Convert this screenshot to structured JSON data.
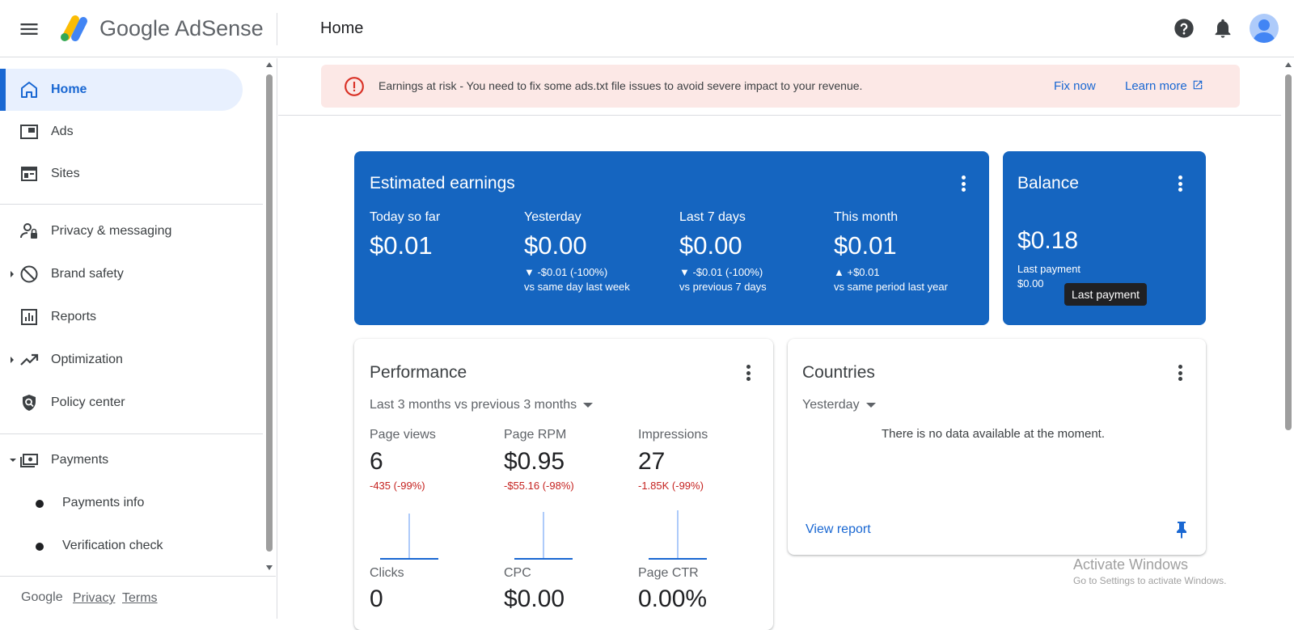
{
  "header": {
    "brand": "Google AdSense",
    "page_title": "Home"
  },
  "sidebar": {
    "items": [
      {
        "label": "Home",
        "icon": "home-icon"
      },
      {
        "label": "Ads",
        "icon": "ads-icon"
      },
      {
        "label": "Sites",
        "icon": "sites-icon"
      },
      {
        "label": "Privacy & messaging",
        "icon": "privacy-icon"
      },
      {
        "label": "Brand safety",
        "icon": "block-icon"
      },
      {
        "label": "Reports",
        "icon": "reports-icon"
      },
      {
        "label": "Optimization",
        "icon": "trending-icon"
      },
      {
        "label": "Policy center",
        "icon": "policy-icon"
      },
      {
        "label": "Payments",
        "icon": "payments-icon"
      }
    ],
    "subitems": [
      {
        "label": "Payments info"
      },
      {
        "label": "Verification check"
      }
    ],
    "footer": {
      "google": "Google",
      "privacy": "Privacy",
      "terms": "Terms"
    }
  },
  "alert": {
    "text": "Earnings at risk - You need to fix some ads.txt file issues to avoid severe impact to your revenue.",
    "fix": "Fix now",
    "learn": "Learn more",
    "color": "#d93025"
  },
  "earnings": {
    "title": "Estimated earnings",
    "metrics": [
      {
        "label": "Today so far",
        "value": "$0.01",
        "change": "",
        "compare": ""
      },
      {
        "label": "Yesterday",
        "value": "$0.00",
        "change": "▼ -$0.01 (-100%)",
        "compare": "vs same day last week"
      },
      {
        "label": "Last 7 days",
        "value": "$0.00",
        "change": "▼ -$0.01 (-100%)",
        "compare": "vs previous 7 days"
      },
      {
        "label": "This month",
        "value": "$0.01",
        "change": "▲ +$0.01",
        "compare": "vs same period last year"
      }
    ]
  },
  "balance": {
    "title": "Balance",
    "value": "$0.18",
    "last_payment_label": "Last payment",
    "last_payment_value": "$0.00",
    "tooltip": "Last payment"
  },
  "performance": {
    "title": "Performance",
    "range": "Last 3 months vs previous 3 months",
    "metrics": [
      {
        "label": "Page views",
        "value": "6",
        "change": "-435 (-99%)"
      },
      {
        "label": "Page RPM",
        "value": "$0.95",
        "change": "-$55.16 (-98%)"
      },
      {
        "label": "Impressions",
        "value": "27",
        "change": "-1.85K (-99%)"
      },
      {
        "label": "Clicks",
        "value": "0"
      },
      {
        "label": "CPC",
        "value": "$0.00"
      },
      {
        "label": "Page CTR",
        "value": "0.00%"
      }
    ]
  },
  "countries": {
    "title": "Countries",
    "range": "Yesterday",
    "empty": "There is no data available at the moment.",
    "view_report": "View report"
  },
  "watermark": {
    "line1": "Activate Windows",
    "line2": "Go to Settings to activate Windows."
  },
  "colors": {
    "accent": "#1967d2",
    "card_blue": "#1565c0",
    "negative": "#c5221f"
  }
}
